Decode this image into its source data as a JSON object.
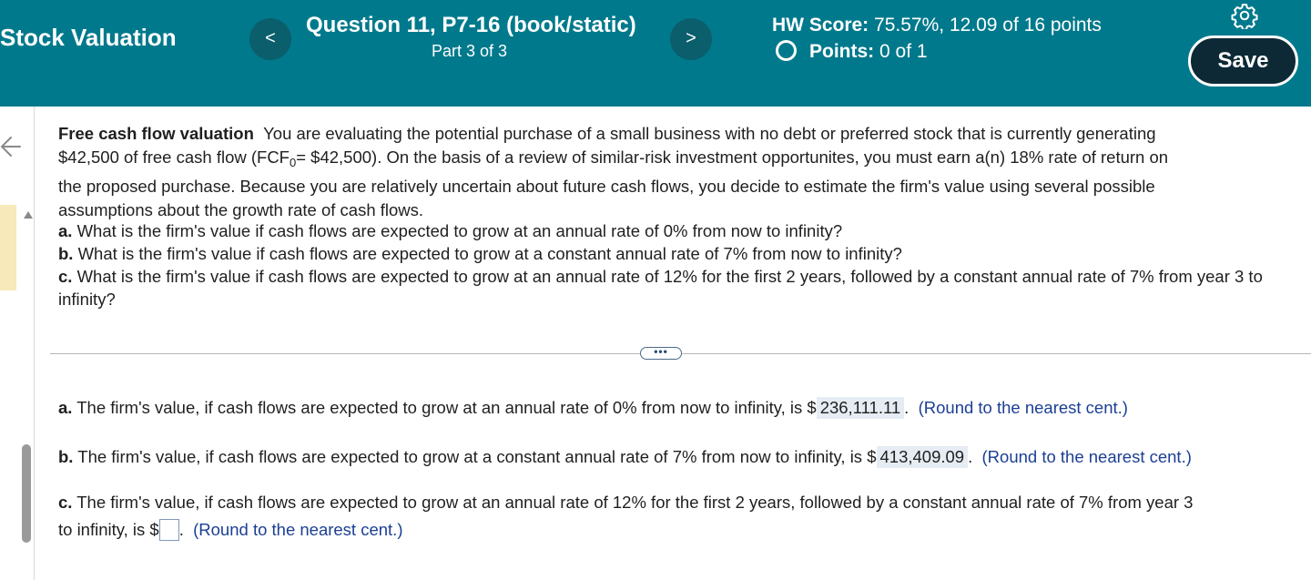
{
  "header": {
    "course_title": "Stock Valuation",
    "prev_label": "<",
    "next_label": ">",
    "question_title": "Question 11, P7-16 (book/static)",
    "question_part": "Part 3 of 3",
    "hw_score_label": "HW Score:",
    "hw_score_value": "75.57%, 12.09 of 16 points",
    "points_label": "Points:",
    "points_value": "0 of 1",
    "save_label": "Save"
  },
  "problem": {
    "title": "Free cash flow valuation",
    "line1_rest": "You are evaluating the potential purchase of a small business with no debt or preferred stock that is currently generating",
    "line2_start": "$42,500 of free cash flow (FCF",
    "line2_sub": "0",
    "line2_rest": "= $42,500). On the basis of a review of similar-risk investment opportunites, you must earn a(n) 18% rate of return on",
    "line3": "the proposed purchase. Because you are relatively uncertain about future cash flows, you decide to estimate the firm's value using several possible",
    "line4": "assumptions about the growth rate of cash flows.",
    "a_label": "a.",
    "a_text": "What is the firm's value if cash flows are expected to grow at an annual rate of 0% from now to infinity?",
    "b_label": "b.",
    "b_text": "What is the firm's value if cash flows are expected to grow at a constant annual rate of 7% from now to infinity?",
    "c_label": "c.",
    "c_text": "What is the firm's value if cash flows are expected to grow at an annual rate of 12% for the first 2 years, followed by a constant annual rate of 7% from year 3 to infinity?"
  },
  "divider": {
    "more_label": "•••"
  },
  "answers": {
    "a_label": "a.",
    "a_text": "The firm's value, if cash flows are expected to grow at an annual rate of 0% from now to infinity, is $",
    "a_value": "236,111.11",
    "a_hint": "(Round to the nearest cent.)",
    "b_label": "b.",
    "b_text": "The firm's value, if cash flows are expected to grow at a constant annual rate of 7% from now to infinity, is $",
    "b_value": "413,409.09",
    "b_hint": "(Round to the nearest cent.)",
    "c_label": "c.",
    "c_text_line1": "The firm's value, if cash flows are expected to grow at an annual rate of 12% for the first 2 years, followed by a constant annual rate of 7% from year 3",
    "c_text_line2": "to infinity, is $",
    "c_value": "",
    "c_hint": "(Round to the nearest cent.)"
  },
  "icons": {
    "settings": "gear-icon",
    "back": "back-arrow-icon",
    "status": "circle-icon"
  },
  "colors": {
    "header_bg": "#00798c",
    "save_bg": "#0e2936",
    "hint_text": "#1c3f94",
    "answer_bg": "#e6ecf3"
  }
}
